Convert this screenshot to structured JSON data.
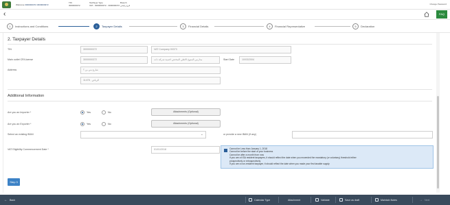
{
  "topbar": {
    "welcome_label": "Welcome",
    "welcome_value": "3000000372 3000000372",
    "tin_label": "TIN",
    "tin_value": "3000000372",
    "taxpayer_type_label": "TaxPayer Type",
    "taxpayer_type_value": "VAT - 3000000372 - 3000000372",
    "branch_label": "Branch",
    "branch_value": "فرع رئيسي",
    "change_password": "Change Password"
  },
  "navbar": {
    "faq": "FAQ"
  },
  "steps": [
    {
      "number": "1",
      "label": "Instructions and Conditions",
      "active": false
    },
    {
      "number": "2",
      "label": "Taxpayer Details",
      "active": true
    },
    {
      "number": "3",
      "label": "Financial Details",
      "active": false
    },
    {
      "number": "4",
      "label": "Financial Representative",
      "active": false
    },
    {
      "number": "5",
      "label": "Declaration",
      "active": false
    }
  ],
  "taxpayer_details": {
    "section_title": "2. Taxpayer Details",
    "tin_label": "TIN",
    "tin_value": "3000000372",
    "company_value": "VAT Company 00373",
    "main_outlet_label": "Main outlet CR/License",
    "cr_value": "3000000372",
    "cr_name_value": "مدارس المتوج الاهلي المختص اجنبية شركة ذات",
    "start_date_label": "Start Date",
    "start_date_value": "10/03/2004",
    "address_label": "Address",
    "address_line1": "شارع بني بن ؟",
    "address_line2": "11478 , الرياض"
  },
  "additional_info": {
    "title": "Additional Information",
    "importer_label": "Are you an Importer *",
    "exporter_label": "Are you an Exporter *",
    "yes_label": "Yes",
    "no_label": "No",
    "importer_selected": "Yes",
    "exporter_selected": "Yes",
    "attachments_label": "Attachments (Optional)",
    "iban_select_label": "Select an existing IBAN",
    "iban_new_label": "or provide a new IBAN (if any)",
    "vat_start_label": "VAT Eligibility Commencement Date *",
    "vat_start_value": "01/01/2018",
    "info_lines": [
      "Cannot be Less than January 1, 2018",
      "Cannot be before the start of your business",
      "Cannot be after a month from now",
      "If you are a KSA resident taxpayers, it should reflect the date when you exceeded the mandatory (or voluntary) threshold either",
      "prospectively or retrospectively",
      "If you are a non-resident taxpayer, it should reflect the date when you made your first taxable supply"
    ]
  },
  "actions": {
    "step3": "Step 3"
  },
  "bottombar": {
    "back": "Back",
    "calendar_type": "Calendar Type",
    "attachment": "Attachment",
    "validate": "Validate",
    "save_as_draft": "Save as draft",
    "maintain_notes": "Maintain Notes",
    "next": "Next"
  },
  "colors": {
    "accent": "#2b5f99",
    "faq_green": "#2b8a3e",
    "info_bg": "#dce9f7",
    "bottom_bar": "#3a4a5c"
  }
}
